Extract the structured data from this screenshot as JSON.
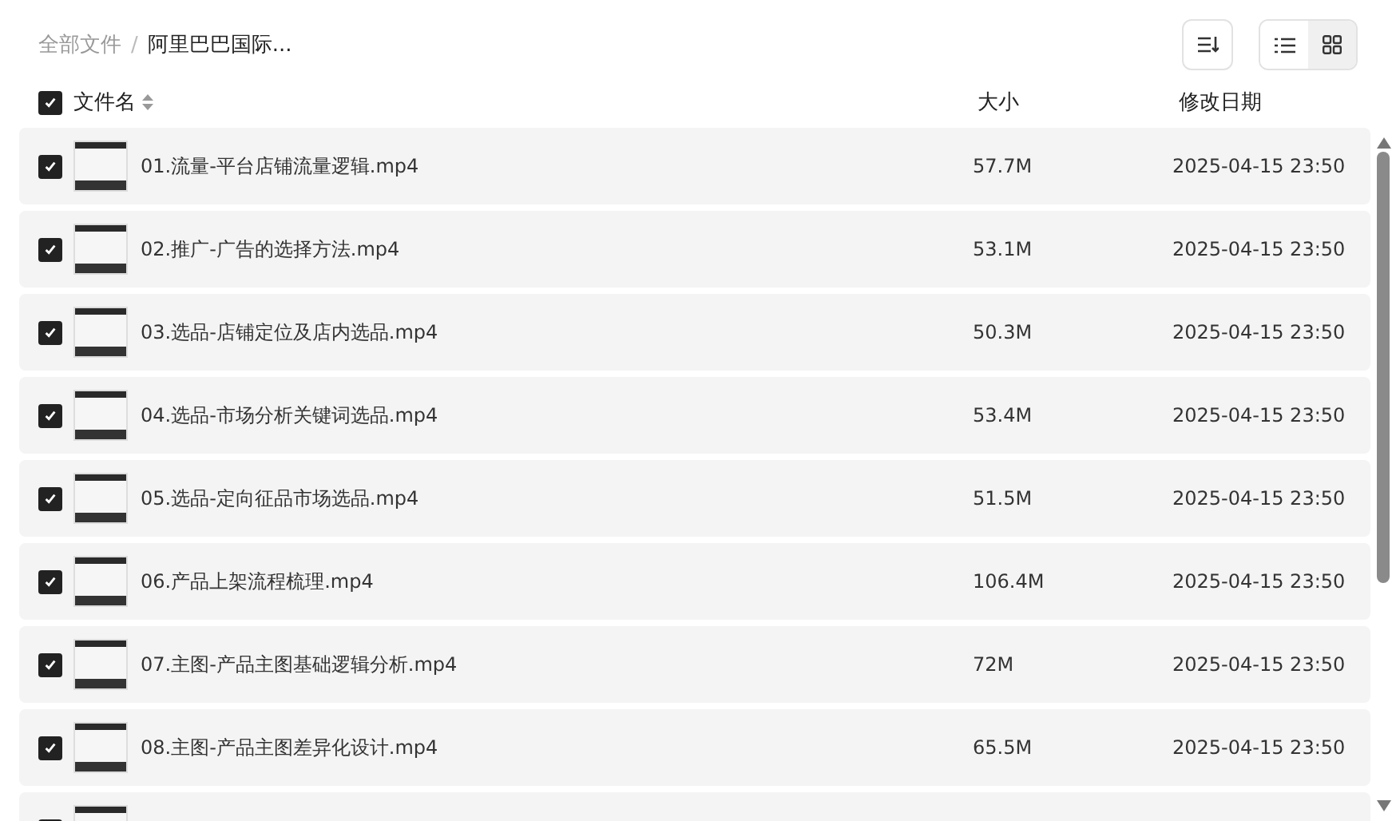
{
  "breadcrumb": {
    "root": "全部文件",
    "separator": "/",
    "current": "阿里巴巴国际..."
  },
  "toolbar": {
    "view_modes": [
      {
        "kind": "list",
        "selected": true
      },
      {
        "kind": "grid",
        "selected": false
      }
    ]
  },
  "table": {
    "all_checked": true,
    "columns": [
      "文件名",
      "大小",
      "修改日期"
    ],
    "rows": [
      {
        "name": "01.流量-平台店铺流量逻辑.mp4",
        "size": "57.7M",
        "date": "2025-04-15 23:50",
        "checked": true
      },
      {
        "name": "02.推广-广告的选择方法.mp4",
        "size": "53.1M",
        "date": "2025-04-15 23:50",
        "checked": true
      },
      {
        "name": "03.选品-店铺定位及店内选品.mp4",
        "size": "50.3M",
        "date": "2025-04-15 23:50",
        "checked": true
      },
      {
        "name": "04.选品-市场分析关键词选品.mp4",
        "size": "53.4M",
        "date": "2025-04-15 23:50",
        "checked": true
      },
      {
        "name": "05.选品-定向征品市场选品.mp4",
        "size": "51.5M",
        "date": "2025-04-15 23:50",
        "checked": true
      },
      {
        "name": "06.产品上架流程梳理.mp4",
        "size": "106.4M",
        "date": "2025-04-15 23:50",
        "checked": true
      },
      {
        "name": "07.主图-产品主图基础逻辑分析.mp4",
        "size": "72M",
        "date": "2025-04-15 23:50",
        "checked": true
      },
      {
        "name": "08.主图-产品主图差异化设计.mp4",
        "size": "65.5M",
        "date": "2025-04-15 23:50",
        "checked": true
      }
    ],
    "partial_row": {
      "checked": true
    }
  }
}
